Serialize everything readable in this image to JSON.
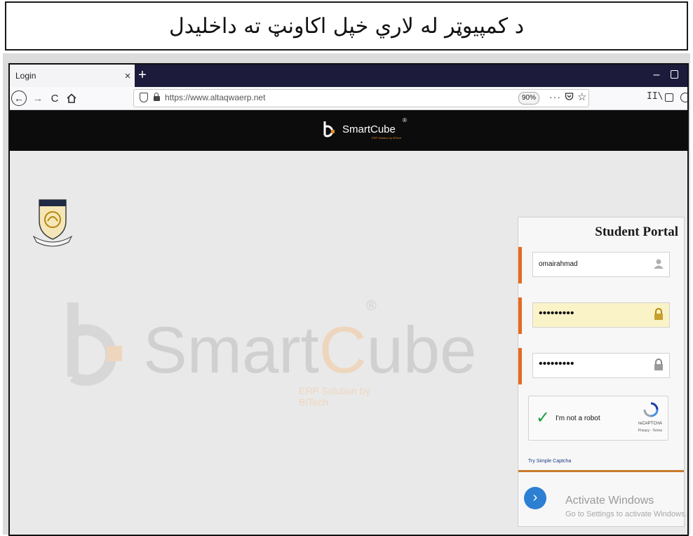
{
  "caption": {
    "text": "د کمپیوټر له لاري خپل اکاونټ ته داخلیدل"
  },
  "browser": {
    "tab_title": "Login",
    "tab_close": "×",
    "new_tab": "+",
    "minimize": "–",
    "url": "https://www.altaqwaerp.net",
    "zoom": "90%",
    "page_actions": "···",
    "bookmark_star": "☆",
    "library": "II\\"
  },
  "site_header": {
    "logo_text": "SmartCube",
    "logo_tagline": "ERP Solution by BiTech",
    "registered": "®"
  },
  "watermark": {
    "text_a": "Smart",
    "text_c": "C",
    "text_b": "ube",
    "registered": "®",
    "tagline": "ERP Solution by BiTech"
  },
  "login": {
    "title": "Student Portal",
    "username": "omairahmad",
    "password_mask": "•••••••••",
    "confirm_mask": "•••••••••",
    "captcha_label": "I'm not a robot",
    "captcha_brand": "reCAPTCHA",
    "captcha_terms": "Privacy - Terms",
    "simple_captcha": "Try Simple Captcha",
    "go_button": "›"
  },
  "os_overlay": {
    "activate_title": "Activate Windows",
    "activate_sub": "Go to Settings to activate Windows."
  },
  "colors": {
    "accent": "#e56b1f",
    "header_bg": "#0c0c0c",
    "tab_bar": "#1c1b3c"
  }
}
